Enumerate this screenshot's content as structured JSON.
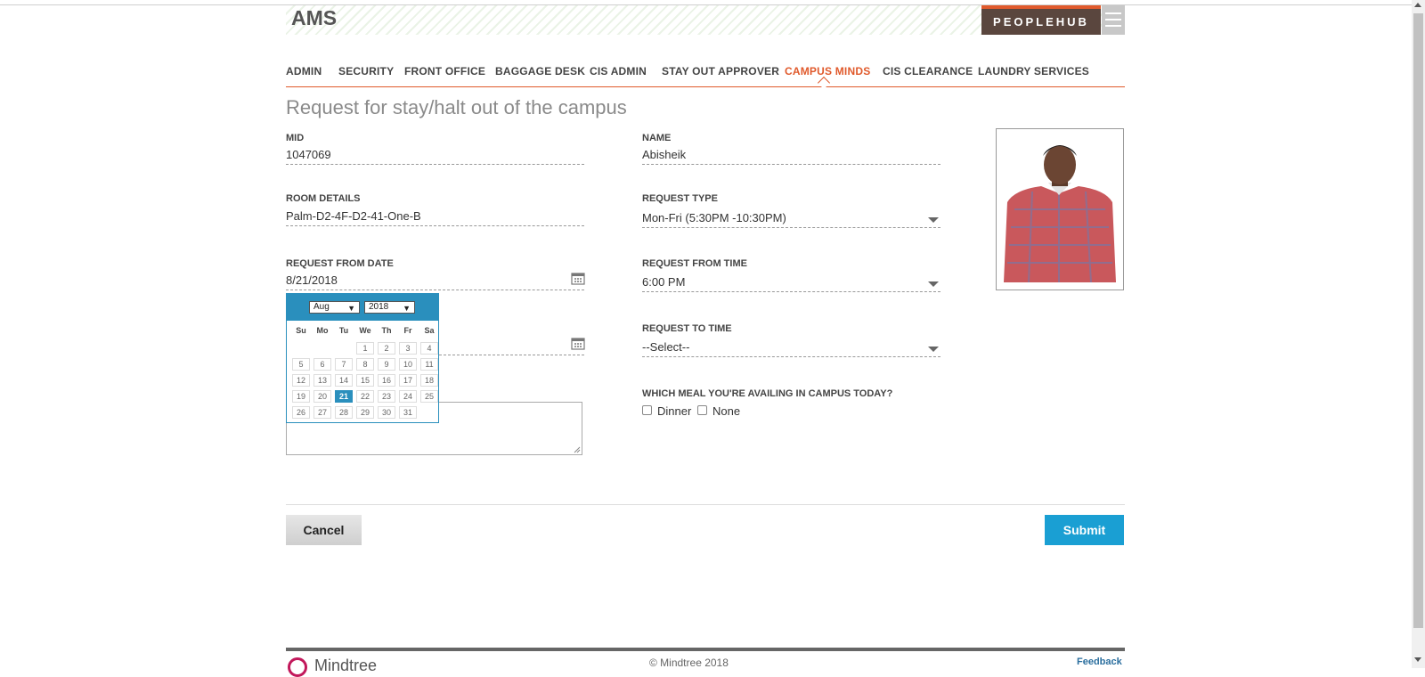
{
  "header": {
    "app_title": "AMS",
    "peoplehub_label": "PEOPLEHUB"
  },
  "nav": {
    "items": [
      "ADMIN",
      "SECURITY",
      "FRONT OFFICE",
      "BAGGAGE DESK",
      "CIS ADMIN",
      "STAY OUT APPROVER",
      "CAMPUS MINDS",
      "CIS CLEARANCE",
      "LAUNDRY SERVICES"
    ],
    "active": "CAMPUS MINDS"
  },
  "page": {
    "title": "Request for stay/halt out of the campus"
  },
  "form": {
    "mid": {
      "label": "MID",
      "value": "1047069"
    },
    "name": {
      "label": "NAME",
      "value": "Abisheik"
    },
    "room": {
      "label": "ROOM DETAILS",
      "value": "Palm-D2-4F-D2-41-One-B"
    },
    "request_type": {
      "label": "REQUEST TYPE",
      "value": "Mon-Fri (5:30PM -10:30PM)"
    },
    "from_date": {
      "label": "REQUEST FROM DATE",
      "value": "8/21/2018"
    },
    "from_time": {
      "label": "REQUEST FROM TIME",
      "value": "6:00 PM"
    },
    "to_time": {
      "label": "REQUEST TO TIME",
      "value": "--Select--"
    },
    "meal": {
      "label": "WHICH MEAL YOU'RE AVAILING IN CAMPUS TODAY?",
      "options": [
        "Dinner",
        "None"
      ]
    }
  },
  "calendar": {
    "month": "Aug",
    "year": "2018",
    "weekdays": [
      "Su",
      "Mo",
      "Tu",
      "We",
      "Th",
      "Fr",
      "Sa"
    ],
    "selected_day": "21",
    "weeks": [
      [
        "",
        "",
        "",
        "1",
        "2",
        "3",
        "4"
      ],
      [
        "5",
        "6",
        "7",
        "8",
        "9",
        "10",
        "11"
      ],
      [
        "12",
        "13",
        "14",
        "15",
        "16",
        "17",
        "18"
      ],
      [
        "19",
        "20",
        "21",
        "22",
        "23",
        "24",
        "25"
      ],
      [
        "26",
        "27",
        "28",
        "29",
        "30",
        "31",
        ""
      ]
    ]
  },
  "actions": {
    "cancel": "Cancel",
    "submit": "Submit"
  },
  "footer": {
    "logo": "Mindtree",
    "copyright": "© Mindtree 2018",
    "feedback": "Feedback"
  },
  "colors": {
    "accent": "#e05a2c",
    "primary": "#1a9fd3",
    "calendar": "#2a8fbd",
    "peoplehub_bg": "#5a463e"
  }
}
